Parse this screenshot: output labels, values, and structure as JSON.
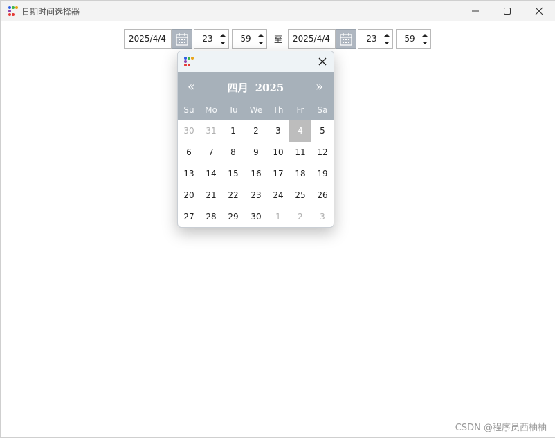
{
  "window": {
    "title": "日期时间选择器",
    "controls": {
      "minimize": "minimize-icon",
      "maximize": "maximize-icon",
      "close": "close-icon"
    }
  },
  "range": {
    "start": {
      "date": "2025/4/4",
      "hour": "23",
      "minute": "59"
    },
    "separator": "至",
    "end": {
      "date": "2025/4/4",
      "hour": "23",
      "minute": "59"
    }
  },
  "calendar": {
    "prev": "«",
    "next": "»",
    "month": "四月",
    "year": "2025",
    "weekdays": [
      "Su",
      "Mo",
      "Tu",
      "We",
      "Th",
      "Fr",
      "Sa"
    ],
    "weeks": [
      [
        "30",
        "31",
        "1",
        "2",
        "3",
        "4",
        "5"
      ],
      [
        "6",
        "7",
        "8",
        "9",
        "10",
        "11",
        "12"
      ],
      [
        "13",
        "14",
        "15",
        "16",
        "17",
        "18",
        "19"
      ],
      [
        "20",
        "21",
        "22",
        "23",
        "24",
        "25",
        "26"
      ],
      [
        "27",
        "28",
        "29",
        "30",
        "1",
        "2",
        "3"
      ]
    ],
    "outside_month": [
      [
        0,
        0
      ],
      [
        0,
        1
      ],
      [
        4,
        4
      ],
      [
        4,
        5
      ],
      [
        4,
        6
      ]
    ],
    "selected": [
      0,
      5
    ]
  },
  "colors": {
    "header": "#a7b1ba",
    "selected_day": "#bdbdbd",
    "icon_dots": [
      "#2d5be3",
      "#3bb54a",
      "#e8a317",
      "#e53935",
      "#8e44ad",
      "#e53935"
    ]
  },
  "watermark": "CSDN @程序员西柚柚"
}
